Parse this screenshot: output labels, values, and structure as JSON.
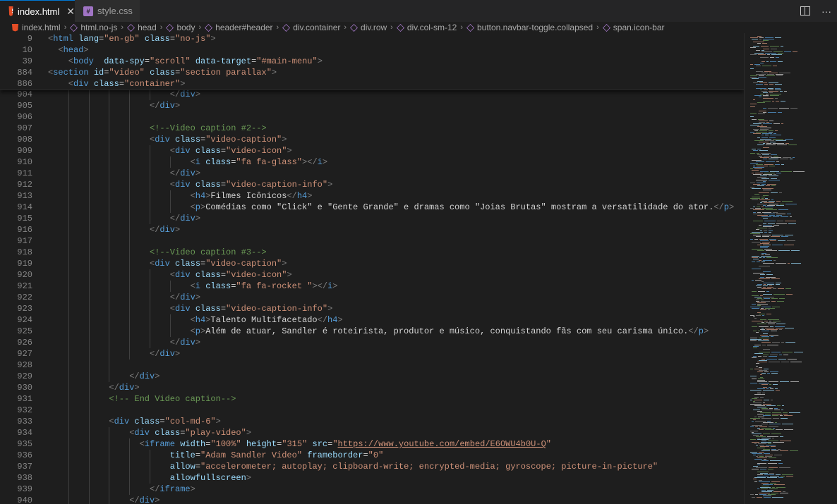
{
  "tabs": [
    {
      "label": "index.html",
      "icon": "html5-icon",
      "active": true,
      "close": "✕"
    },
    {
      "label": "style.css",
      "icon": "css3-icon",
      "active": false
    }
  ],
  "breadcrumb": [
    {
      "label": "index.html",
      "icon": "html5-icon"
    },
    {
      "label": "html.no-js",
      "icon": "element-cube-icon"
    },
    {
      "label": "head",
      "icon": "element-cube-icon"
    },
    {
      "label": "body",
      "icon": "element-cube-icon"
    },
    {
      "label": "header#header",
      "icon": "element-cube-icon"
    },
    {
      "label": "div.container",
      "icon": "element-cube-icon"
    },
    {
      "label": "div.row",
      "icon": "element-cube-icon"
    },
    {
      "label": "div.col-sm-12",
      "icon": "element-cube-icon"
    },
    {
      "label": "button.navbar-toggle.collapsed",
      "icon": "element-cube-icon"
    },
    {
      "label": "span.icon-bar",
      "icon": "element-cube-icon"
    }
  ],
  "sticky_lines": [
    {
      "n": "9",
      "indent": 0,
      "parts": [
        [
          "p",
          "<"
        ],
        [
          "t",
          "html"
        ],
        [
          "x",
          " "
        ],
        [
          "a",
          "lang"
        ],
        [
          "x",
          "="
        ],
        [
          "s",
          "\"en-gb\""
        ],
        [
          "x",
          " "
        ],
        [
          "a",
          "class"
        ],
        [
          "x",
          "="
        ],
        [
          "s",
          "\"no-js\""
        ],
        [
          "p",
          ">"
        ]
      ]
    },
    {
      "n": "10",
      "indent": 2,
      "parts": [
        [
          "p",
          "<"
        ],
        [
          "t",
          "head"
        ],
        [
          "p",
          ">"
        ]
      ]
    },
    {
      "n": "39",
      "indent": 4,
      "parts": [
        [
          "p",
          "<"
        ],
        [
          "t",
          "body"
        ],
        [
          "x",
          "  "
        ],
        [
          "a",
          "data-spy"
        ],
        [
          "x",
          "="
        ],
        [
          "s",
          "\"scroll\""
        ],
        [
          "x",
          " "
        ],
        [
          "a",
          "data-target"
        ],
        [
          "x",
          "="
        ],
        [
          "s",
          "\"#main-menu\""
        ],
        [
          "p",
          ">"
        ]
      ]
    },
    {
      "n": "884",
      "indent": 0,
      "parts": [
        [
          "p",
          "<"
        ],
        [
          "t",
          "section"
        ],
        [
          "x",
          " "
        ],
        [
          "a",
          "id"
        ],
        [
          "x",
          "="
        ],
        [
          "s",
          "\"video\""
        ],
        [
          "x",
          " "
        ],
        [
          "a",
          "class"
        ],
        [
          "x",
          "="
        ],
        [
          "s",
          "\"section parallax\""
        ],
        [
          "p",
          ">"
        ]
      ]
    },
    {
      "n": "886",
      "indent": 4,
      "parts": [
        [
          "p",
          "<"
        ],
        [
          "t",
          "div"
        ],
        [
          "x",
          " "
        ],
        [
          "a",
          "class"
        ],
        [
          "x",
          "="
        ],
        [
          "s",
          "\"container\""
        ],
        [
          "p",
          ">"
        ]
      ]
    }
  ],
  "lines": [
    {
      "n": "904",
      "indent": 24,
      "parts": [
        [
          "p",
          "</"
        ],
        [
          "t",
          "div"
        ],
        [
          "p",
          ">"
        ]
      ]
    },
    {
      "n": "905",
      "indent": 20,
      "parts": [
        [
          "p",
          "</"
        ],
        [
          "t",
          "div"
        ],
        [
          "p",
          ">"
        ]
      ]
    },
    {
      "n": "906",
      "indent": 0,
      "parts": []
    },
    {
      "n": "907",
      "indent": 20,
      "parts": [
        [
          "c",
          "<!--Video caption #2-->"
        ]
      ]
    },
    {
      "n": "908",
      "indent": 20,
      "parts": [
        [
          "p",
          "<"
        ],
        [
          "t",
          "div"
        ],
        [
          "x",
          " "
        ],
        [
          "a",
          "class"
        ],
        [
          "x",
          "="
        ],
        [
          "s",
          "\"video-caption\""
        ],
        [
          "p",
          ">"
        ]
      ]
    },
    {
      "n": "909",
      "indent": 24,
      "parts": [
        [
          "p",
          "<"
        ],
        [
          "t",
          "div"
        ],
        [
          "x",
          " "
        ],
        [
          "a",
          "class"
        ],
        [
          "x",
          "="
        ],
        [
          "s",
          "\"video-icon\""
        ],
        [
          "p",
          ">"
        ]
      ]
    },
    {
      "n": "910",
      "indent": 28,
      "parts": [
        [
          "p",
          "<"
        ],
        [
          "t",
          "i"
        ],
        [
          "x",
          " "
        ],
        [
          "a",
          "class"
        ],
        [
          "x",
          "="
        ],
        [
          "s",
          "\"fa fa-glass\""
        ],
        [
          "p",
          "></"
        ],
        [
          "t",
          "i"
        ],
        [
          "p",
          ">"
        ]
      ]
    },
    {
      "n": "911",
      "indent": 24,
      "parts": [
        [
          "p",
          "</"
        ],
        [
          "t",
          "div"
        ],
        [
          "p",
          ">"
        ]
      ]
    },
    {
      "n": "912",
      "indent": 24,
      "parts": [
        [
          "p",
          "<"
        ],
        [
          "t",
          "div"
        ],
        [
          "x",
          " "
        ],
        [
          "a",
          "class"
        ],
        [
          "x",
          "="
        ],
        [
          "s",
          "\"video-caption-info\""
        ],
        [
          "p",
          ">"
        ]
      ]
    },
    {
      "n": "913",
      "indent": 28,
      "parts": [
        [
          "p",
          "<"
        ],
        [
          "t",
          "h4"
        ],
        [
          "p",
          ">"
        ],
        [
          "x",
          "Filmes Icônicos"
        ],
        [
          "p",
          "</"
        ],
        [
          "t",
          "h4"
        ],
        [
          "p",
          ">"
        ]
      ]
    },
    {
      "n": "914",
      "indent": 28,
      "parts": [
        [
          "p",
          "<"
        ],
        [
          "t",
          "p"
        ],
        [
          "p",
          ">"
        ],
        [
          "x",
          "Comédias como \"Click\" e \"Gente Grande\" e dramas como \"Joias Brutas\" mostram a versatilidade do ator."
        ],
        [
          "p",
          "</"
        ],
        [
          "t",
          "p"
        ],
        [
          "p",
          ">"
        ]
      ]
    },
    {
      "n": "915",
      "indent": 24,
      "parts": [
        [
          "p",
          "</"
        ],
        [
          "t",
          "div"
        ],
        [
          "p",
          ">"
        ]
      ]
    },
    {
      "n": "916",
      "indent": 20,
      "parts": [
        [
          "p",
          "</"
        ],
        [
          "t",
          "div"
        ],
        [
          "p",
          ">"
        ]
      ]
    },
    {
      "n": "917",
      "indent": 0,
      "parts": []
    },
    {
      "n": "918",
      "indent": 20,
      "parts": [
        [
          "c",
          "<!--Video caption #3-->"
        ]
      ]
    },
    {
      "n": "919",
      "indent": 20,
      "parts": [
        [
          "p",
          "<"
        ],
        [
          "t",
          "div"
        ],
        [
          "x",
          " "
        ],
        [
          "a",
          "class"
        ],
        [
          "x",
          "="
        ],
        [
          "s",
          "\"video-caption\""
        ],
        [
          "p",
          ">"
        ]
      ]
    },
    {
      "n": "920",
      "indent": 24,
      "parts": [
        [
          "p",
          "<"
        ],
        [
          "t",
          "div"
        ],
        [
          "x",
          " "
        ],
        [
          "a",
          "class"
        ],
        [
          "x",
          "="
        ],
        [
          "s",
          "\"video-icon\""
        ],
        [
          "p",
          ">"
        ]
      ]
    },
    {
      "n": "921",
      "indent": 28,
      "parts": [
        [
          "p",
          "<"
        ],
        [
          "t",
          "i"
        ],
        [
          "x",
          " "
        ],
        [
          "a",
          "class"
        ],
        [
          "x",
          "="
        ],
        [
          "s",
          "\"fa fa-rocket \""
        ],
        [
          "p",
          "></"
        ],
        [
          "t",
          "i"
        ],
        [
          "p",
          ">"
        ]
      ]
    },
    {
      "n": "922",
      "indent": 24,
      "parts": [
        [
          "p",
          "</"
        ],
        [
          "t",
          "div"
        ],
        [
          "p",
          ">"
        ]
      ]
    },
    {
      "n": "923",
      "indent": 24,
      "parts": [
        [
          "p",
          "<"
        ],
        [
          "t",
          "div"
        ],
        [
          "x",
          " "
        ],
        [
          "a",
          "class"
        ],
        [
          "x",
          "="
        ],
        [
          "s",
          "\"video-caption-info\""
        ],
        [
          "p",
          ">"
        ]
      ]
    },
    {
      "n": "924",
      "indent": 28,
      "parts": [
        [
          "p",
          "<"
        ],
        [
          "t",
          "h4"
        ],
        [
          "p",
          ">"
        ],
        [
          "x",
          "Talento Multifacetado"
        ],
        [
          "p",
          "</"
        ],
        [
          "t",
          "h4"
        ],
        [
          "p",
          ">"
        ]
      ]
    },
    {
      "n": "925",
      "indent": 28,
      "parts": [
        [
          "p",
          "<"
        ],
        [
          "t",
          "p"
        ],
        [
          "p",
          ">"
        ],
        [
          "x",
          "Além de atuar, Sandler é roteirista, produtor e músico, conquistando fãs com seu carisma único."
        ],
        [
          "p",
          "</"
        ],
        [
          "t",
          "p"
        ],
        [
          "p",
          ">"
        ]
      ]
    },
    {
      "n": "926",
      "indent": 24,
      "parts": [
        [
          "p",
          "</"
        ],
        [
          "t",
          "div"
        ],
        [
          "p",
          ">"
        ]
      ]
    },
    {
      "n": "927",
      "indent": 20,
      "parts": [
        [
          "p",
          "</"
        ],
        [
          "t",
          "div"
        ],
        [
          "p",
          ">"
        ]
      ]
    },
    {
      "n": "928",
      "indent": 0,
      "parts": []
    },
    {
      "n": "929",
      "indent": 16,
      "parts": [
        [
          "p",
          "</"
        ],
        [
          "t",
          "div"
        ],
        [
          "p",
          ">"
        ]
      ]
    },
    {
      "n": "930",
      "indent": 12,
      "parts": [
        [
          "p",
          "</"
        ],
        [
          "t",
          "div"
        ],
        [
          "p",
          ">"
        ]
      ]
    },
    {
      "n": "931",
      "indent": 12,
      "parts": [
        [
          "c",
          "<!-- End Video caption-->"
        ]
      ]
    },
    {
      "n": "932",
      "indent": 0,
      "parts": []
    },
    {
      "n": "933",
      "indent": 12,
      "parts": [
        [
          "p",
          "<"
        ],
        [
          "t",
          "div"
        ],
        [
          "x",
          " "
        ],
        [
          "a",
          "class"
        ],
        [
          "x",
          "="
        ],
        [
          "s",
          "\"col-md-6\""
        ],
        [
          "p",
          ">"
        ]
      ]
    },
    {
      "n": "934",
      "indent": 16,
      "parts": [
        [
          "p",
          "<"
        ],
        [
          "t",
          "div"
        ],
        [
          "x",
          " "
        ],
        [
          "a",
          "class"
        ],
        [
          "x",
          "="
        ],
        [
          "s",
          "\"play-video\""
        ],
        [
          "p",
          ">"
        ]
      ]
    },
    {
      "n": "935",
      "indent": 18,
      "parts": [
        [
          "p",
          "<"
        ],
        [
          "t",
          "iframe"
        ],
        [
          "x",
          " "
        ],
        [
          "a",
          "width"
        ],
        [
          "x",
          "="
        ],
        [
          "s",
          "\"100%\""
        ],
        [
          "x",
          " "
        ],
        [
          "a",
          "height"
        ],
        [
          "x",
          "="
        ],
        [
          "s",
          "\"315\""
        ],
        [
          "x",
          " "
        ],
        [
          "a",
          "src"
        ],
        [
          "x",
          "="
        ],
        [
          "s",
          "\""
        ],
        [
          "u",
          "https://www.youtube.com/embed/E6OWU4b0U-Q"
        ],
        [
          "s",
          "\""
        ]
      ]
    },
    {
      "n": "936",
      "indent": 24,
      "parts": [
        [
          "a",
          "title"
        ],
        [
          "x",
          "="
        ],
        [
          "s",
          "\"Adam Sandler Video\""
        ],
        [
          "x",
          " "
        ],
        [
          "a",
          "frameborder"
        ],
        [
          "x",
          "="
        ],
        [
          "s",
          "\"0\""
        ]
      ]
    },
    {
      "n": "937",
      "indent": 24,
      "parts": [
        [
          "a",
          "allow"
        ],
        [
          "x",
          "="
        ],
        [
          "s",
          "\"accelerometer; autoplay; clipboard-write; encrypted-media; gyroscope; picture-in-picture\""
        ]
      ]
    },
    {
      "n": "938",
      "indent": 24,
      "parts": [
        [
          "a",
          "allowfullscreen"
        ],
        [
          "p",
          ">"
        ]
      ]
    },
    {
      "n": "939",
      "indent": 20,
      "parts": [
        [
          "p",
          "</"
        ],
        [
          "t",
          "iframe"
        ],
        [
          "p",
          ">"
        ]
      ]
    },
    {
      "n": "940",
      "indent": 16,
      "parts": [
        [
          "p",
          "</"
        ],
        [
          "t",
          "div"
        ],
        [
          "p",
          ">"
        ]
      ]
    }
  ],
  "actions": [
    {
      "name": "split-editor-icon"
    },
    {
      "name": "more-actions-icon",
      "glyph": "···"
    }
  ],
  "colors": {
    "tag": "#569cd6",
    "attr": "#9cdcfe",
    "string": "#ce9178",
    "comment": "#6a9955",
    "accent": "#0078d4"
  }
}
